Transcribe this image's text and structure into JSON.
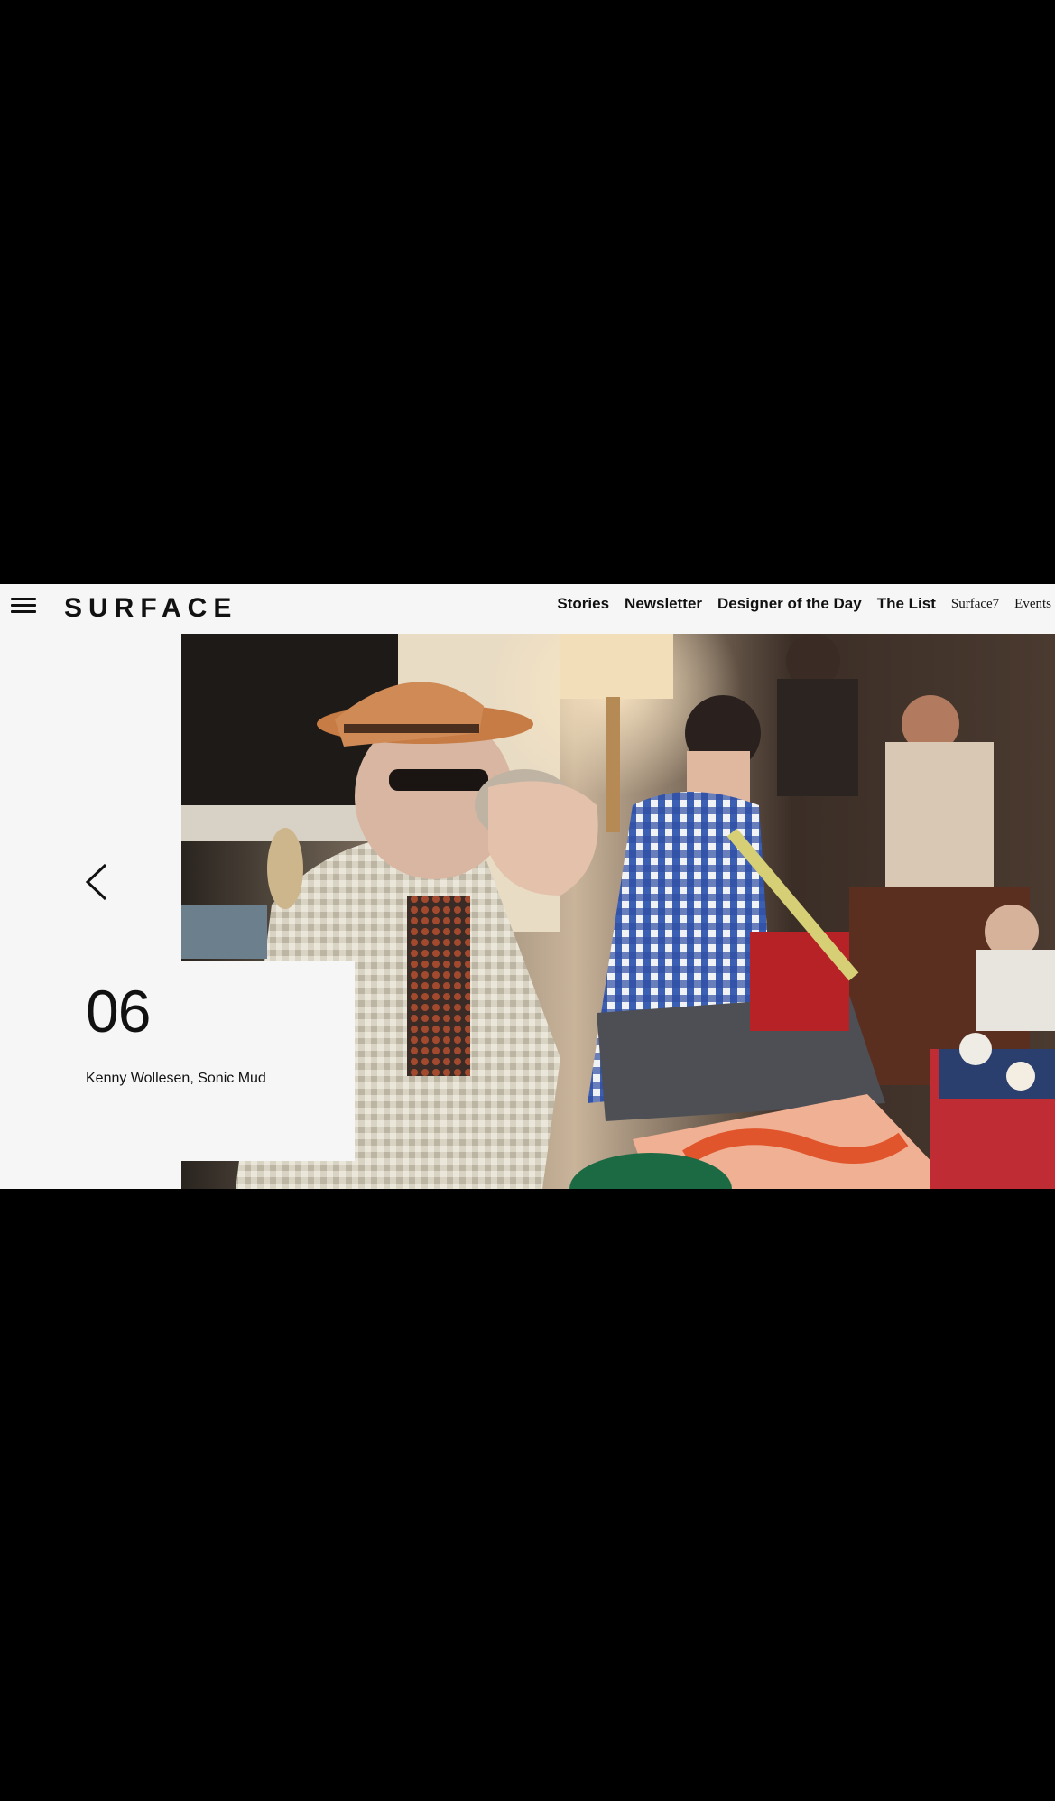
{
  "header": {
    "logo": "SURFACE",
    "menu_icon": "hamburger-menu-icon",
    "nav": [
      {
        "label": "Stories",
        "style": "bold"
      },
      {
        "label": "Newsletter",
        "style": "bold"
      },
      {
        "label": "Designer of the Day",
        "style": "bold"
      },
      {
        "label": "The List",
        "style": "bold"
      },
      {
        "label": "Surface7",
        "style": "serif"
      },
      {
        "label": "Events",
        "style": "serif"
      }
    ]
  },
  "slideshow": {
    "prev_icon": "chevron-left-icon",
    "slide_number": "06",
    "caption": "Kenny Wollesen, Sonic Mud"
  },
  "colors": {
    "background": "#000000",
    "panel": "#f6f6f6",
    "text": "#111111"
  }
}
